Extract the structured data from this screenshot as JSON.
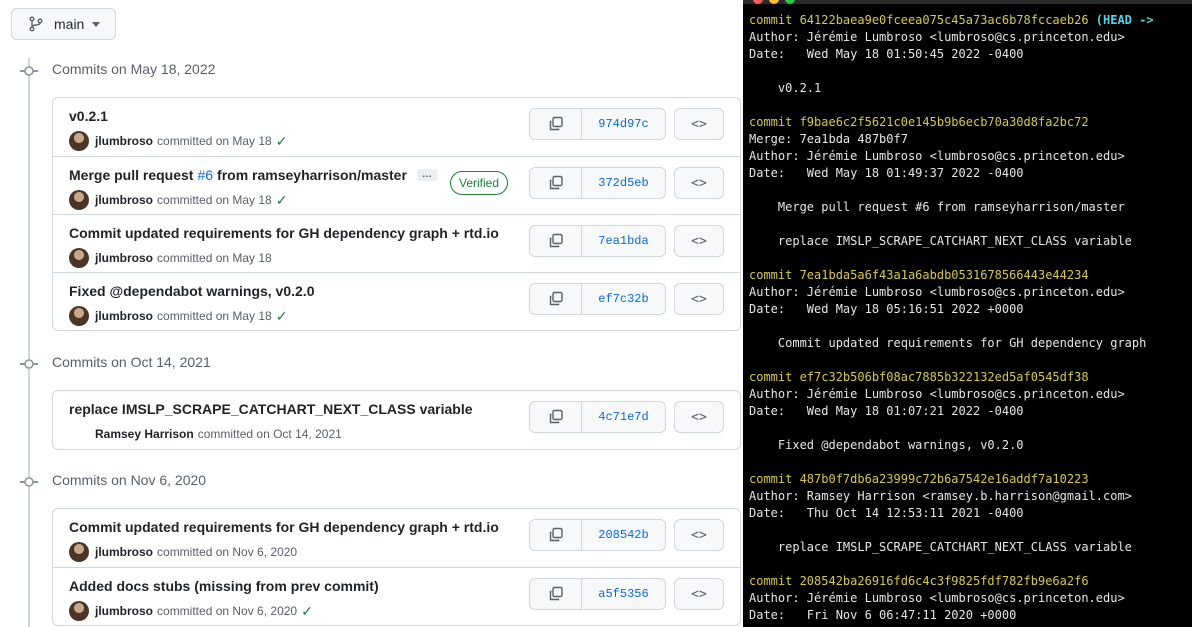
{
  "branch": {
    "label": "main"
  },
  "groups": [
    {
      "heading": "Commits on May 18, 2022",
      "commits": [
        {
          "title": "v0.2.1",
          "author": "jlumbroso",
          "date": "committed on May 18",
          "check": "✓",
          "sha": "974d97c"
        },
        {
          "title_prefix": "Merge pull request",
          "pr": "#6",
          "title_suffix": "from ramseyharrison/master",
          "ellipsis": "…",
          "verified": "Verified",
          "author": "jlumbroso",
          "date": "committed on May 18",
          "check": "✓",
          "sha": "372d5eb"
        },
        {
          "title": "Commit updated requirements for GH dependency graph + rtd.io",
          "author": "jlumbroso",
          "date": "committed on May 18",
          "sha": "7ea1bda"
        },
        {
          "title": "Fixed @dependabot warnings, v0.2.0",
          "author": "jlumbroso",
          "date": "committed on May 18",
          "check": "✓",
          "sha": "ef7c32b"
        }
      ]
    },
    {
      "heading": "Commits on Oct 14, 2021",
      "commits": [
        {
          "title": "replace IMSLP_SCRAPE_CATCHART_NEXT_CLASS variable",
          "author": "Ramsey Harrison",
          "date": "committed on Oct 14, 2021",
          "sha": "4c71e7d"
        }
      ]
    },
    {
      "heading": "Commits on Nov 6, 2020",
      "commits": [
        {
          "title": "Commit updated requirements for GH dependency graph + rtd.io",
          "author": "jlumbroso",
          "date": "committed on Nov 6, 2020",
          "sha": "208542b"
        },
        {
          "title": "Added docs stubs (missing from prev commit)",
          "author": "jlumbroso",
          "date": "committed on Nov 6, 2020",
          "check": "✓",
          "sha": "a5f5356"
        }
      ]
    }
  ],
  "browse_label": "<>",
  "terminal": {
    "colors": {
      "commit": "#d7c84b",
      "head": "#55d6e8",
      "text": "#e6e6e6",
      "bg": "#000000"
    },
    "lines": [
      {
        "commit": "commit 64122baea9e0fceea075c45a73ac6b78fccaeb26",
        "head": " (HEAD ->"
      },
      {
        "text": "Author: Jérémie Lumbroso <lumbroso@cs.princeton.edu>"
      },
      {
        "text": "Date:   Wed May 18 01:50:45 2022 -0400"
      },
      {
        "text": ""
      },
      {
        "text": "    v0.2.1"
      },
      {
        "text": ""
      },
      {
        "commit": "commit f9bae6c2f5621c0e145b9b6ecb70a30d8fa2bc72"
      },
      {
        "text": "Merge: 7ea1bda 487b0f7"
      },
      {
        "text": "Author: Jérémie Lumbroso <lumbroso@cs.princeton.edu>"
      },
      {
        "text": "Date:   Wed May 18 01:49:37 2022 -0400"
      },
      {
        "text": ""
      },
      {
        "text": "    Merge pull request #6 from ramseyharrison/master"
      },
      {
        "text": ""
      },
      {
        "text": "    replace IMSLP_SCRAPE_CATCHART_NEXT_CLASS variable"
      },
      {
        "text": ""
      },
      {
        "commit": "commit 7ea1bda5a6f43a1a6abdb0531678566443e44234"
      },
      {
        "text": "Author: Jérémie Lumbroso <lumbroso@cs.princeton.edu>"
      },
      {
        "text": "Date:   Wed May 18 05:16:51 2022 +0000"
      },
      {
        "text": ""
      },
      {
        "text": "    Commit updated requirements for GH dependency graph"
      },
      {
        "text": ""
      },
      {
        "commit": "commit ef7c32b506bf08ac7885b322132ed5af0545df38"
      },
      {
        "text": "Author: Jérémie Lumbroso <lumbroso@cs.princeton.edu>"
      },
      {
        "text": "Date:   Wed May 18 01:07:21 2022 -0400"
      },
      {
        "text": ""
      },
      {
        "text": "    Fixed @dependabot warnings, v0.2.0"
      },
      {
        "text": ""
      },
      {
        "commit": "commit 487b0f7db6a23999c72b6a7542e16addf7a10223"
      },
      {
        "text": "Author: Ramsey Harrison <ramsey.b.harrison@gmail.com>"
      },
      {
        "text": "Date:   Thu Oct 14 12:53:11 2021 -0400"
      },
      {
        "text": ""
      },
      {
        "text": "    replace IMSLP_SCRAPE_CATCHART_NEXT_CLASS variable"
      },
      {
        "text": ""
      },
      {
        "commit": "commit 208542ba26916fd6c4c3f9825fdf782fb9e6a2f6"
      },
      {
        "text": "Author: Jérémie Lumbroso <lumbroso@cs.princeton.edu>"
      },
      {
        "text": "Date:   Fri Nov 6 06:47:11 2020 +0000"
      }
    ]
  }
}
